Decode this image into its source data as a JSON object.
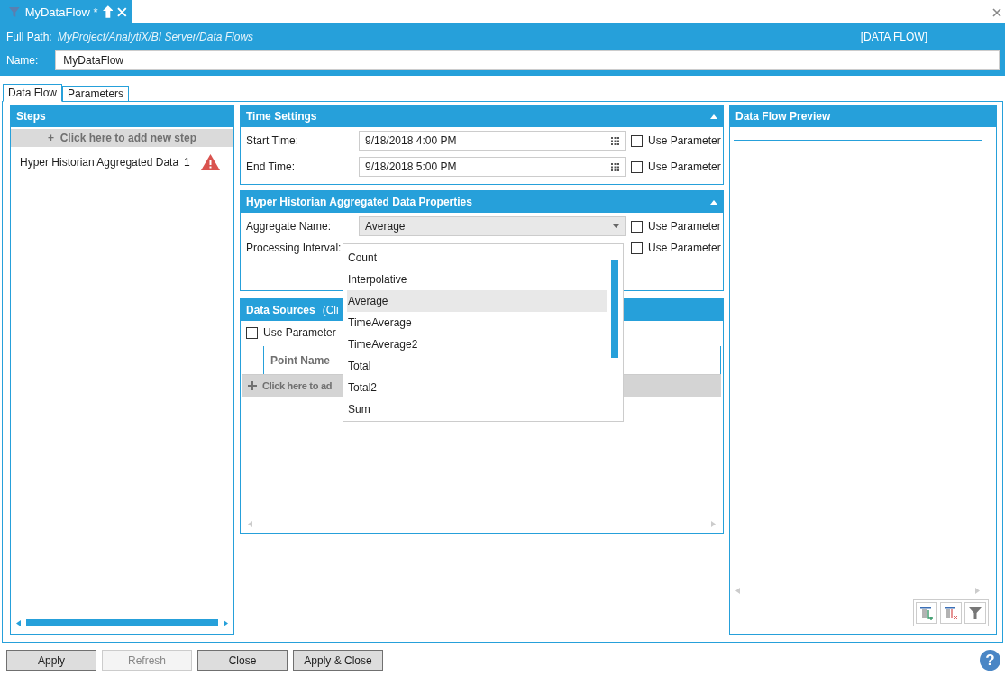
{
  "document_tab": {
    "title": "MyDataFlow *"
  },
  "header": {
    "full_path_label": "Full Path:",
    "full_path": "MyProject/AnalytiX/BI Server/Data Flows",
    "type": "[DATA FLOW]",
    "name_label": "Name:",
    "name": "MyDataFlow"
  },
  "tabs": [
    {
      "label": "Data Flow",
      "selected": true
    },
    {
      "label": "Parameters",
      "selected": false
    }
  ],
  "steps": {
    "title": "Steps",
    "add": "+  Click here to add new step",
    "items": [
      {
        "label": "Hyper Historian Aggregated Data",
        "count": "1",
        "warning": true
      }
    ]
  },
  "time_settings": {
    "title": "Time Settings",
    "rows": [
      {
        "label": "Start Time:",
        "value": "9/18/2018 4:00 PM",
        "use_parameter": "Use Parameter",
        "checked": false
      },
      {
        "label": "End Time:",
        "value": "9/18/2018 5:00 PM",
        "use_parameter": "Use Parameter",
        "checked": false
      }
    ]
  },
  "aggregate_properties": {
    "title": "Hyper Historian Aggregated Data Properties",
    "rows": [
      {
        "kind": "dropdown",
        "label": "Aggregate Name:",
        "value": "Average",
        "use_parameter": "Use Parameter",
        "checked": false
      },
      {
        "kind": "covered",
        "label": "Processing Interval:",
        "use_parameter": "Use Parameter",
        "checked": false
      }
    ]
  },
  "dropdown_options": [
    {
      "label": "Count",
      "selected": false
    },
    {
      "label": "Interpolative",
      "selected": false
    },
    {
      "label": "Average",
      "selected": true
    },
    {
      "label": "TimeAverage",
      "selected": false
    },
    {
      "label": "TimeAverage2",
      "selected": false
    },
    {
      "label": "Total",
      "selected": false
    },
    {
      "label": "Total2",
      "selected": false
    },
    {
      "label": "Sum",
      "selected": false
    }
  ],
  "data_sources": {
    "title": "Data Sources",
    "link": "(Cli",
    "use_parameter": "Use Parameter",
    "checked": false,
    "column": "Point Name",
    "add": "Click here to ad"
  },
  "preview": {
    "title": "Data Flow Preview"
  },
  "buttons": [
    {
      "label": "Apply",
      "disabled": false
    },
    {
      "label": "Refresh",
      "disabled": true
    },
    {
      "label": "Close",
      "disabled": false
    },
    {
      "label": "Apply & Close",
      "disabled": false
    }
  ],
  "help": "?"
}
